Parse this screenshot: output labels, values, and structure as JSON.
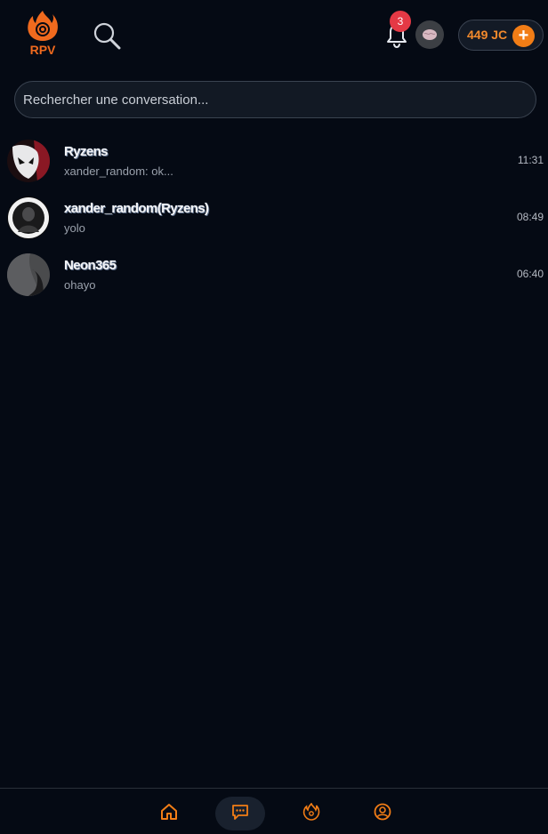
{
  "header": {
    "logo_text": "RPV",
    "notifications_count": "3",
    "coins_label": "449 JC",
    "coins_plus": "+"
  },
  "search": {
    "placeholder": "Rechercher une conversation..."
  },
  "conversations": [
    {
      "name": "Ryzens",
      "last_message": "xander_random: ok...",
      "time": "11:31"
    },
    {
      "name": "xander_random(Ryzens)",
      "last_message": "yolo",
      "time": "08:49"
    },
    {
      "name": "Neon365",
      "last_message": "ohayo",
      "time": "06:40"
    }
  ],
  "bottom_nav": {
    "items": [
      {
        "icon": "home-icon",
        "active": false
      },
      {
        "icon": "chat-icon",
        "active": true
      },
      {
        "icon": "flame-icon",
        "active": false
      },
      {
        "icon": "profile-icon",
        "active": false
      }
    ]
  },
  "colors": {
    "background": "#050a14",
    "accent": "#f27d16",
    "badge": "#e53945"
  }
}
